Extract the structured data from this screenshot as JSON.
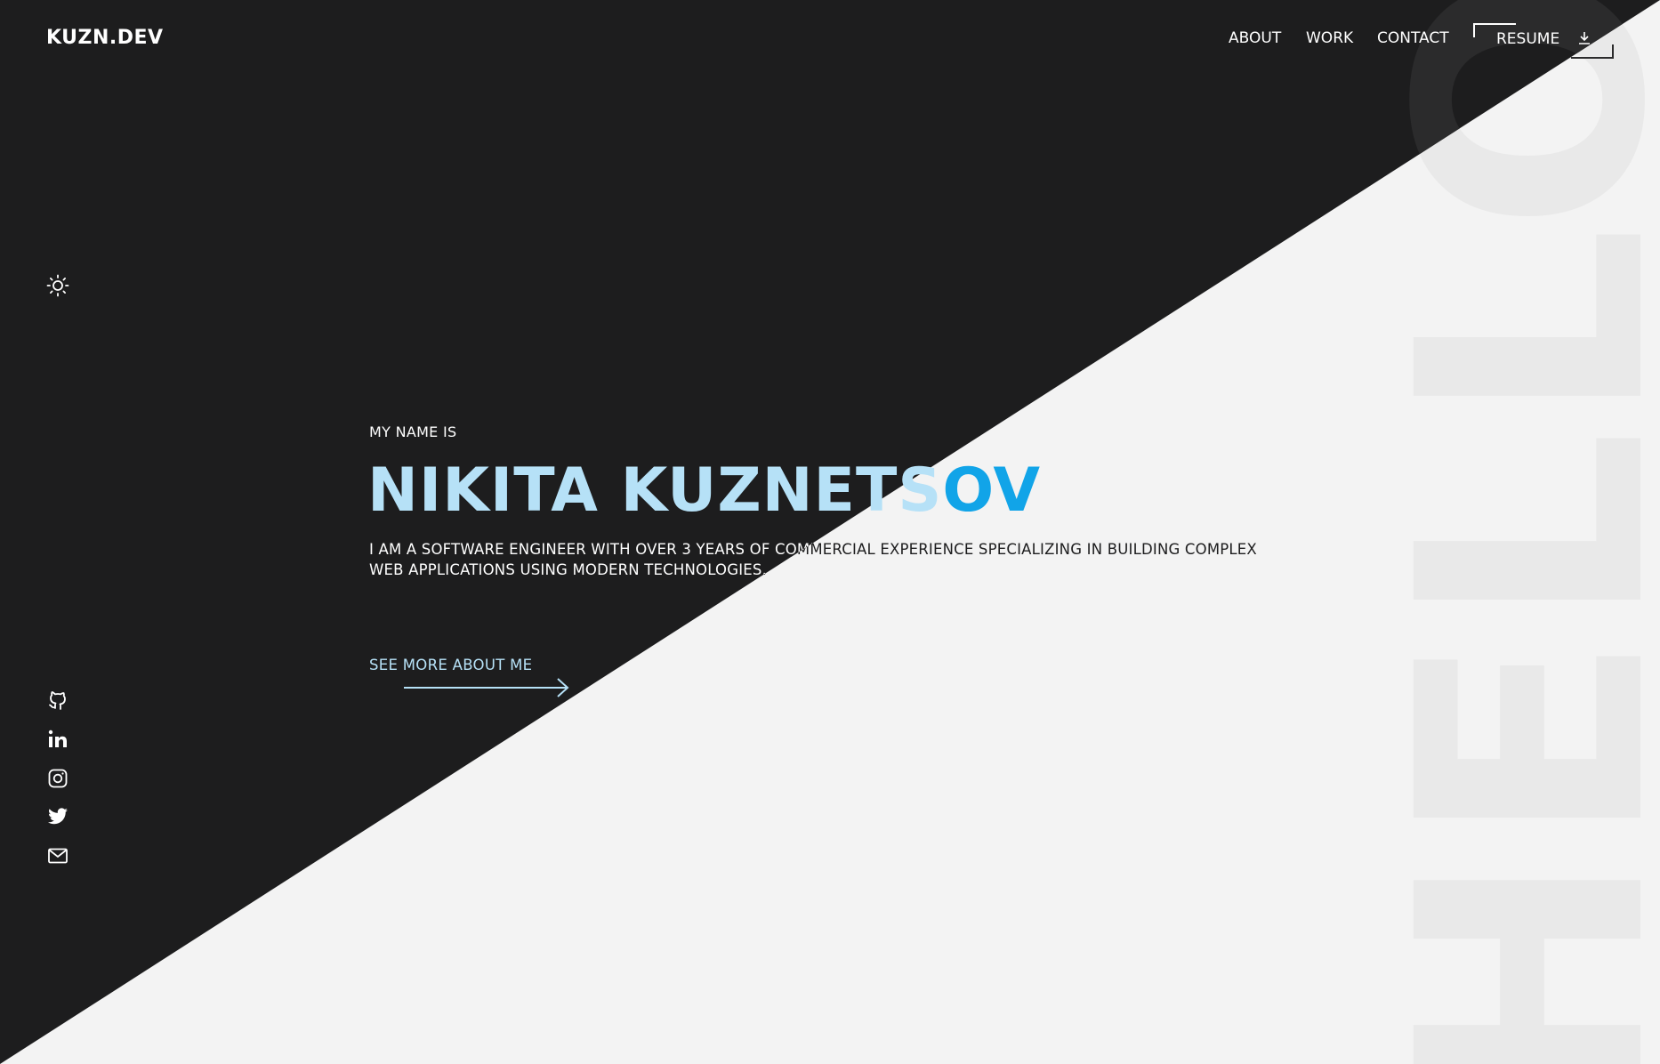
{
  "header": {
    "logo": "KUZN.DEV",
    "nav": [
      {
        "label": "ABOUT"
      },
      {
        "label": "WORK"
      },
      {
        "label": "CONTACT"
      }
    ],
    "resume_label": "RESUME"
  },
  "background_text": "HELLO",
  "hero": {
    "intro": "MY NAME IS",
    "name_part1": "NIKITA KUZNETS",
    "name_part2": "OV",
    "description": "I AM A SOFTWARE ENGINEER WITH OVER 3 YEARS OF COMMERCIAL EXPERIENCE SPECIALIZING IN BUILDING COMPLEX WEB APPLICATIONS USING MODERN TECHNOLOGIES.",
    "cta": "SEE MORE ABOUT ME"
  },
  "icons": {
    "theme": "sun-icon",
    "socials": [
      "github-icon",
      "linkedin-icon",
      "instagram-icon",
      "twitter-icon",
      "mail-icon"
    ],
    "resume": "download-icon"
  },
  "colors": {
    "dark_bg": "#1d1d1e",
    "light_bg": "#f3f3f3",
    "name_light": "#b6e1f7",
    "name_accent": "#11a4e8"
  }
}
